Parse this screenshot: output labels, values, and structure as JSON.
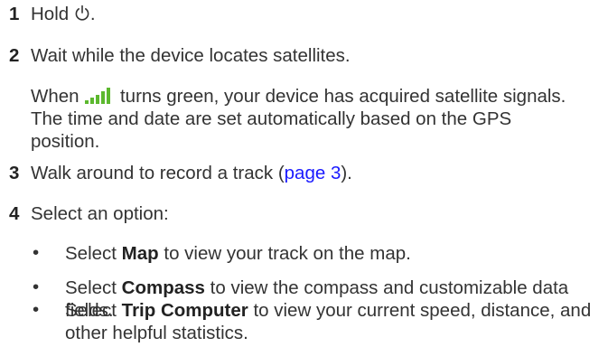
{
  "steps": [
    {
      "num": "1",
      "text_before": "Hold",
      "text_after": "."
    },
    {
      "num": "2",
      "text": "Wait while the device locates satellites."
    },
    {
      "num": "3",
      "text_before": "Walk around to record a track (",
      "link": "page 3",
      "text_after": ")."
    },
    {
      "num": "4",
      "text": "Select an option:"
    }
  ],
  "note": {
    "before": "When",
    "after": "turns green, your device has acquired satellite signals. The time and date are set automatically based on the GPS position."
  },
  "bullets": [
    {
      "pre": "Select ",
      "bold": "Map",
      "post": " to view your track on the map."
    },
    {
      "pre": "Select ",
      "bold": "Compass",
      "post": " to view the compass and customizable data fields."
    },
    {
      "pre": "Select ",
      "bold": "Trip Computer",
      "post": " to view your current speed, distance, and other helpful statistics."
    }
  ],
  "bullet_char": "•",
  "icons": {
    "power": "power-icon",
    "signal": "signal-bars-icon"
  },
  "colors": {
    "text": "#333333",
    "link": "#1a1aff",
    "signal": "#5cb82e"
  }
}
